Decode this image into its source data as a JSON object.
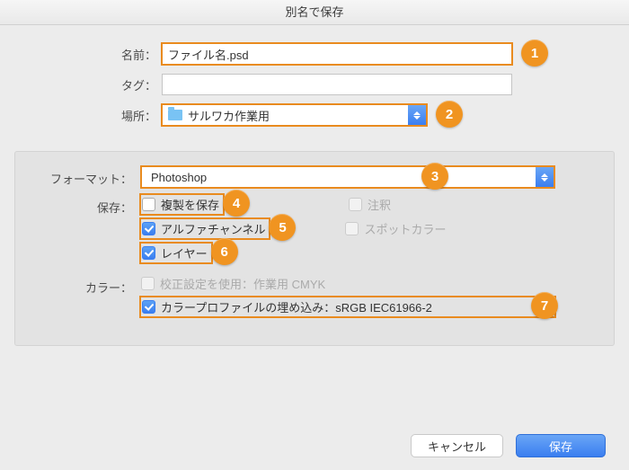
{
  "dialog": {
    "title": "別名で保存"
  },
  "labels": {
    "name": "名前：",
    "tags": "タグ：",
    "where": "場所："
  },
  "fields": {
    "name_value": "ファイル名.psd",
    "tags_value": "",
    "where_value": "サルワカ作業用"
  },
  "format": {
    "label": "フォーマット：",
    "value": "Photoshop"
  },
  "save": {
    "label": "保存：",
    "copy": "複製を保存",
    "annotations": "注釈",
    "alpha": "アルファチャンネル",
    "spot": "スポットカラー",
    "layers": "レイヤー"
  },
  "color": {
    "label": "カラー：",
    "proof": "校正設定を使用：作業用 CMYK",
    "profile": "カラープロファイルの埋め込み：sRGB IEC61966-2"
  },
  "buttons": {
    "cancel": "キャンセル",
    "save": "保存"
  },
  "callouts": {
    "c1": "1",
    "c2": "2",
    "c3": "3",
    "c4": "4",
    "c5": "5",
    "c6": "6",
    "c7": "7"
  }
}
